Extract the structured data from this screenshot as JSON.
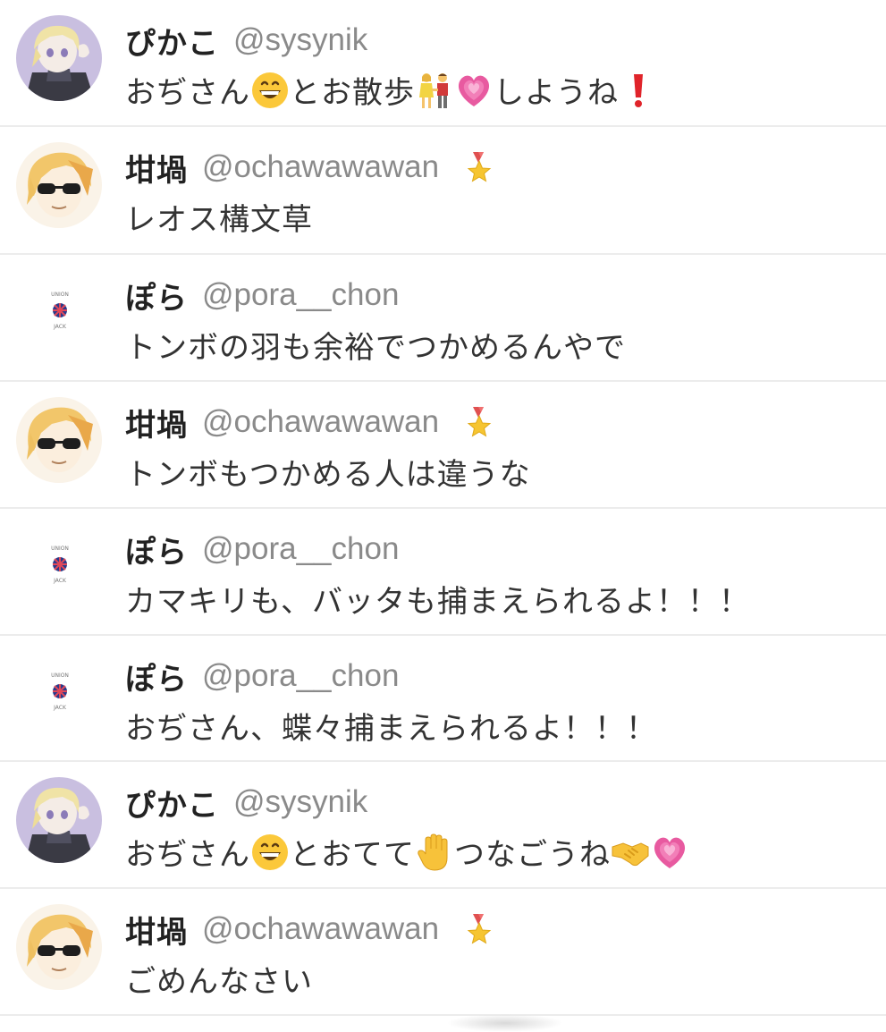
{
  "feed": {
    "posts": [
      {
        "avatar": "avatar-pikako",
        "name": "ぴかこ",
        "handle": "@sysynik",
        "badge": null,
        "message": [
          {
            "t": "text",
            "v": "おぢさん"
          },
          {
            "t": "emoji",
            "v": "grinning-face-emoji"
          },
          {
            "t": "text",
            "v": "とお散歩"
          },
          {
            "t": "emoji",
            "v": "couple-holding-hands-emoji"
          },
          {
            "t": "emoji",
            "v": "growing-heart-emoji"
          },
          {
            "t": "text",
            "v": "しようね"
          },
          {
            "t": "emoji",
            "v": "red-exclamation-emoji"
          }
        ]
      },
      {
        "avatar": "avatar-ochawawawan",
        "name": "坩堝",
        "handle": "@ochawawawan",
        "badge": "medal-icon",
        "message": [
          {
            "t": "text",
            "v": "レオス構文草"
          }
        ]
      },
      {
        "avatar": "avatar-pora",
        "name": "ぽら",
        "handle": "@pora__chon",
        "badge": null,
        "message": [
          {
            "t": "text",
            "v": "トンボの羽も余裕でつかめるんやで"
          }
        ]
      },
      {
        "avatar": "avatar-ochawawawan",
        "name": "坩堝",
        "handle": "@ochawawawan",
        "badge": "medal-icon",
        "message": [
          {
            "t": "text",
            "v": "トンボもつかめる人は違うな"
          }
        ]
      },
      {
        "avatar": "avatar-pora",
        "name": "ぽら",
        "handle": "@pora__chon",
        "badge": null,
        "message": [
          {
            "t": "text",
            "v": "カマキリも、バッタも捕まえられるよ！！！"
          }
        ]
      },
      {
        "avatar": "avatar-pora",
        "name": "ぽら",
        "handle": "@pora__chon",
        "badge": null,
        "message": [
          {
            "t": "text",
            "v": "おぢさん、蝶々捕まえられるよ！！！"
          }
        ]
      },
      {
        "avatar": "avatar-pikako",
        "name": "ぴかこ",
        "handle": "@sysynik",
        "badge": null,
        "message": [
          {
            "t": "text",
            "v": "おぢさん"
          },
          {
            "t": "emoji",
            "v": "grinning-face-emoji"
          },
          {
            "t": "text",
            "v": "とおてて"
          },
          {
            "t": "emoji",
            "v": "raised-hand-emoji"
          },
          {
            "t": "text",
            "v": "つなごうね"
          },
          {
            "t": "emoji",
            "v": "handshake-emoji"
          },
          {
            "t": "emoji",
            "v": "growing-heart-emoji"
          }
        ]
      },
      {
        "avatar": "avatar-ochawawawan",
        "name": "坩堝",
        "handle": "@ochawawawan",
        "badge": "medal-icon",
        "message": [
          {
            "t": "text",
            "v": "ごめんなさい"
          }
        ]
      }
    ]
  },
  "colors": {
    "name": "#222222",
    "handle": "#8a8a8a",
    "message": "#333333",
    "divider": "#ececec"
  }
}
